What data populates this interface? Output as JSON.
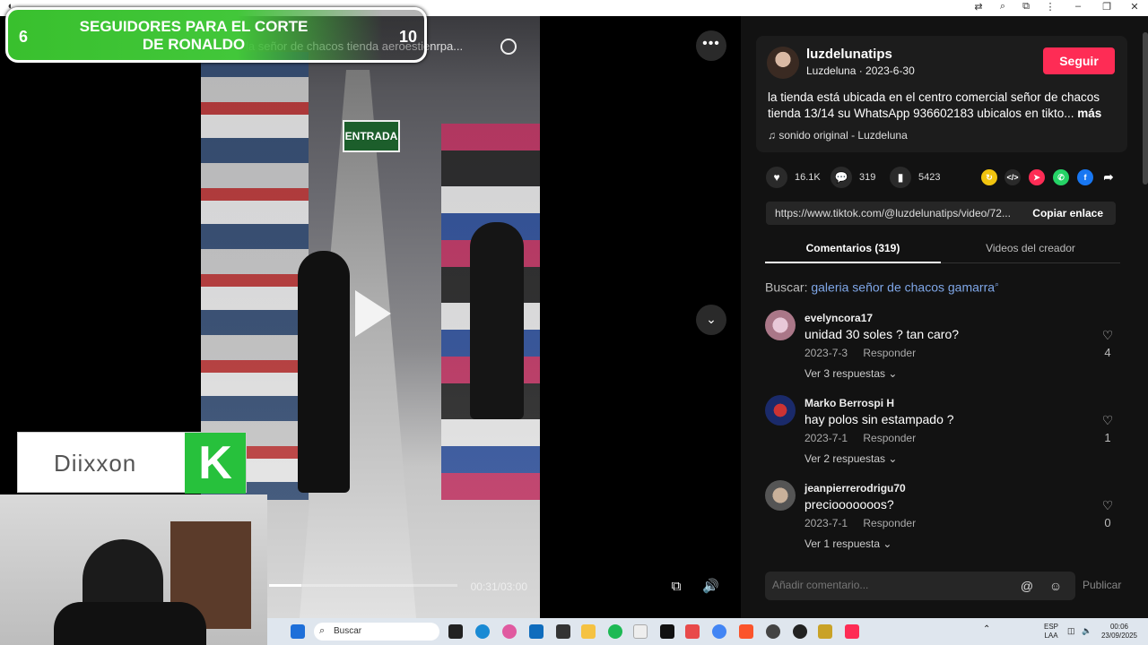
{
  "banner": {
    "left_num": "6",
    "title": "SEGUIDORES PARA EL CORTE DE RONALDO",
    "right_num": "10"
  },
  "video": {
    "search_overlay": "la señor de chacos tienda aeroestienrpa...",
    "sign": "ENTRADA",
    "time": "00:31/03:00",
    "progress": 0.17
  },
  "logo": {
    "text": "Diixxon",
    "mark": "K"
  },
  "post": {
    "username": "luzdelunatips",
    "subline": "Luzdeluna · 2023-6-30",
    "follow_label": "Seguir",
    "description": "la tienda está ubicada en el centro comercial señor de chacos tienda 13/14 su WhatsApp 936602183 ubicalos en tikto...",
    "more_label": "más",
    "sound": "sonido original - Luzdeluna"
  },
  "stats": {
    "likes": "16.1K",
    "comments": "319",
    "saves": "5423"
  },
  "link": {
    "url": "https://www.tiktok.com/@luzdelunatips/video/72...",
    "copy_label": "Copiar enlace"
  },
  "tabs": [
    {
      "label": "Comentarios (319)"
    },
    {
      "label": "Videos del creador"
    }
  ],
  "search_hint": {
    "prefix": "Buscar:",
    "term": "galeria señor de chacos gamarra"
  },
  "comments": [
    {
      "user": "evelyncora17",
      "text": "unidad 30 soles ? tan caro?",
      "date": "2023-7-3",
      "reply": "Responder",
      "replies": "Ver 3 respuestas",
      "likes": "4"
    },
    {
      "user": "Marko Berrospi H",
      "text": "hay polos sin estampado ?",
      "date": "2023-7-1",
      "reply": "Responder",
      "replies": "Ver 2 respuestas",
      "likes": "1"
    },
    {
      "user": "jeanpierrerodrigu70",
      "text": "preciooooooos?",
      "date": "2023-7-1",
      "reply": "Responder",
      "replies": "Ver 1 respuesta",
      "likes": "0"
    }
  ],
  "comment_box": {
    "placeholder": "Añadir comentario...",
    "publish_label": "Publicar"
  },
  "taskbar": {
    "search_label": "Buscar",
    "lang": "ESP\nLAA",
    "time": "00:06",
    "date": "23/09/2025"
  },
  "colors": {
    "accent": "#fe2c55",
    "banner_green": "#42c73a",
    "link_blue": "#7fa7e8"
  }
}
